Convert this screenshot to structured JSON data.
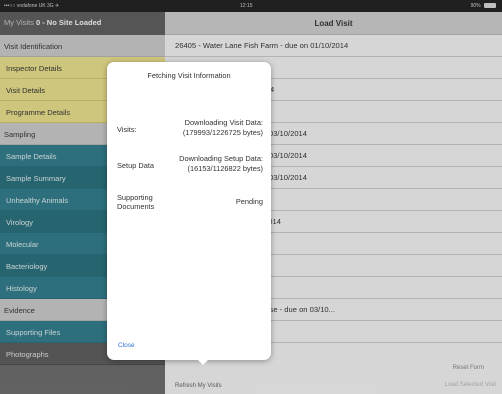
{
  "status_bar": {
    "carrier": "•••○○ vodafone UK  3G  ✈",
    "time": "12:15",
    "battery": "90%"
  },
  "sidebar": {
    "header_prefix": "My Visits",
    "header_bold": "0 - No Site Loaded",
    "visit_identification": "Visit Identification",
    "inspector_details": "Inspector Details",
    "visit_details": "Visit Details",
    "programme_details": "Programme Details",
    "sampling": "Sampling",
    "sample_details": "Sample Details",
    "sample_summary": "Sample Summary",
    "unhealthy_animals": "Unhealthy Animals",
    "virology": "Virology",
    "molecular": "Molecular",
    "bacteriology": "Bacteriology",
    "histology": "Histology",
    "evidence": "Evidence",
    "supporting_files": "Supporting Files",
    "photographs": "Photographs",
    "checkmark": "✓"
  },
  "main": {
    "title": "Load Visit",
    "rows": [
      "26405 - Water Lane Fish Farm - due on 01/10/2014",
      "cs Ltd - due on 19/08/2014",
      "ark Lake - due on 03/10/2014",
      "e on 03/10/2014",
      "Yarmouth Harbour - due on 03/10/2014",
      "Yarmouth Harbour - due on 03/10/2014",
      "Yarmouth Harbour - due on 03/10/2014",
      "03/10/2014",
      "rd Of Agric - due on 03/10/2014",
      "0/2014",
      "ue on 03/10/2014",
      "n 03/10/2014",
      "ll - Gt Ormes Head Lighthouse - due on 03/10...",
      "e on 03/10/2014"
    ],
    "reset_label": "Reset Form",
    "load_label": "Load Selected Visit",
    "refresh_label": "Refresh My Visits"
  },
  "popover": {
    "title": "Fetching Visit Information",
    "visits_label": "Visits:",
    "visits_value_line1": "Downloading Visit Data:",
    "visits_value_line2": "(179993/1226725 bytes)",
    "setup_label": "Setup Data",
    "setup_value_line1": "Downloading Setup Data:",
    "setup_value_line2": "(16153/1126822 bytes)",
    "docs_label_line1": "Supporting",
    "docs_label_line2": "Documents",
    "docs_value": "Pending",
    "close_label": "Close"
  }
}
